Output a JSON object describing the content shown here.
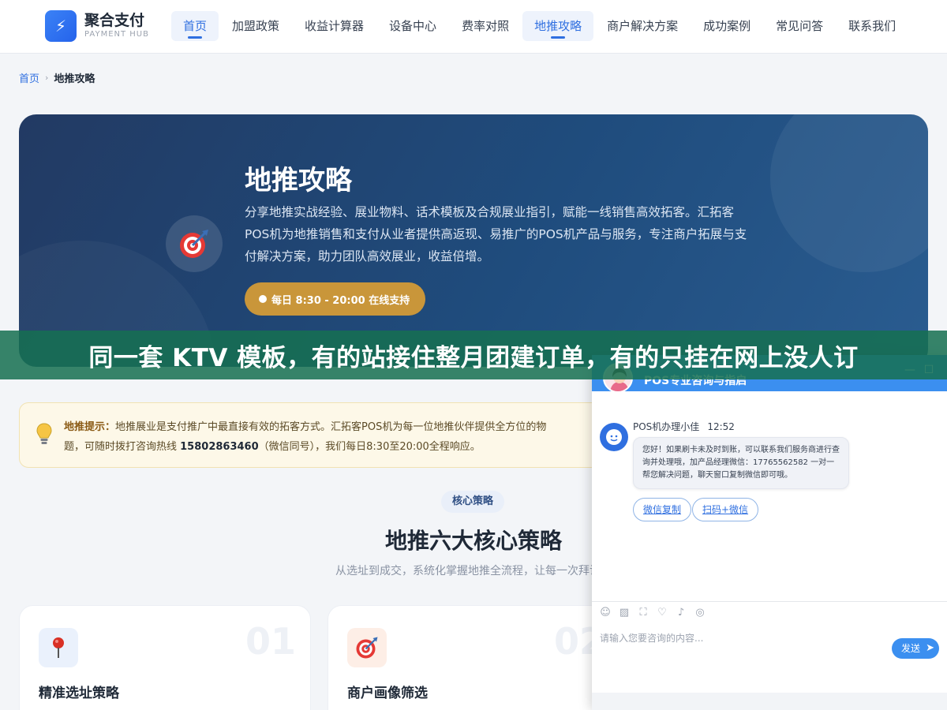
{
  "header": {
    "logo_name": "聚合支付",
    "logo_sub": "PAYMENT HUB",
    "logo_glyph": "⚡",
    "nav": [
      {
        "label": "首页",
        "active": true
      },
      {
        "label": "加盟政策",
        "active": false
      },
      {
        "label": "收益计算器",
        "active": false
      },
      {
        "label": "设备中心",
        "active": false
      },
      {
        "label": "费率对照",
        "active": false
      },
      {
        "label": "地推攻略",
        "active": true
      },
      {
        "label": "商户解决方案",
        "active": false
      },
      {
        "label": "成功案例",
        "active": false
      },
      {
        "label": "常见问答",
        "active": false
      },
      {
        "label": "联系我们",
        "active": false
      }
    ]
  },
  "breadcrumb": {
    "home": "首页",
    "separator": "›",
    "current": "地推攻略"
  },
  "hero": {
    "title": "地推攻略",
    "description": "分享地推实战经验、展业物料、话术模板及合规展业指引，赋能一线销售高效拓客。汇拓客POS机为地推销售和支付从业者提供高返现、易推广的POS机产品与服务，专注商户拓展与支付解决方案，助力团队高效展业，收益倍增。",
    "hours": "每日 8:30 - 20:00 在线支持",
    "icon": "target-icon"
  },
  "banner": {
    "text": "同一套 KTV 模板，有的站接住整月团建订单，有的只挂在网上没人订"
  },
  "tip": {
    "label": "地推提示：",
    "text_before": "地推展业是支付推广中最直接有效的拓客方式。汇拓客POS机为每一位地推伙伴提供全方位的物",
    "text_line2_before": "题，可随时拨打咨询热线 ",
    "phone": "15802863460",
    "text_after": "（微信同号），我们每日8:30至20:00全程响应。"
  },
  "section": {
    "tag": "核心策略",
    "title": "地推六大核心策略",
    "subtitle": "从选址到成交，系统化掌握地推全流程，让每一次拜访都"
  },
  "cards": [
    {
      "num": "01",
      "title": "精准选址策略",
      "icon": "pin-icon"
    },
    {
      "num": "02",
      "title": "商户画像筛选",
      "icon": "target-icon"
    }
  ],
  "chat": {
    "title": "POS专业咨询与指启",
    "agent_name": "POS机办理小佳",
    "time": "12:52",
    "message": "您好！如果刷卡未及时到账，可以联系我们服务商进行查询并处理哦，加产品经理微信：17765562582 一对一帮您解决问题，聊天窗口复制微信即可哦。",
    "button_copy": "微信复制",
    "button_scan": "扫码+微信",
    "input_placeholder": "请输入您要咨询的内容...",
    "send": "发送",
    "minimize": "—",
    "maximize": "☐"
  },
  "colors": {
    "accent": "#2f6fe0",
    "hero_bg": "#1f4c7d",
    "pill": "#c9963a",
    "banner": "#167052",
    "chat_header": "#3b8ff0"
  }
}
